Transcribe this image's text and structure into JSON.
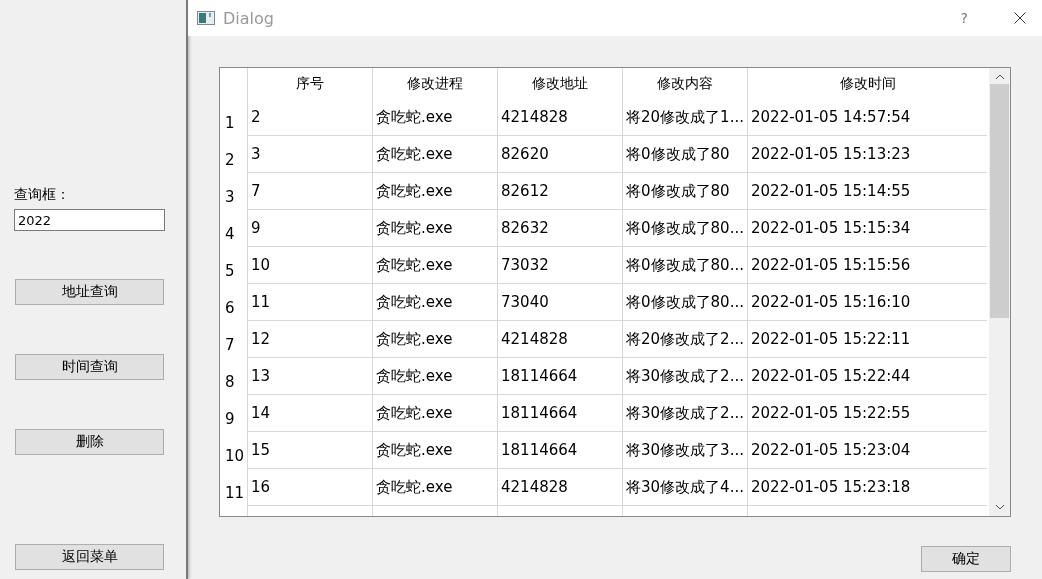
{
  "sidebar": {
    "search_label": "查询框：",
    "search_value": "2022",
    "buttons": [
      "地址查询",
      "时间查询",
      "删除",
      "返回菜单"
    ]
  },
  "window": {
    "title": "Dialog",
    "help": "?"
  },
  "table": {
    "columns": [
      "序号",
      "修改进程",
      "修改地址",
      "修改内容",
      "修改时间"
    ],
    "rows": [
      {
        "header": "1",
        "cells": [
          "2",
          "贪吃蛇.exe",
          "4214828",
          "将20修改成了1...",
          "2022-01-05 14:57:54"
        ]
      },
      {
        "header": "2",
        "cells": [
          "3",
          "贪吃蛇.exe",
          "82620",
          "将0修改成了80",
          "2022-01-05 15:13:23"
        ]
      },
      {
        "header": "3",
        "cells": [
          "7",
          "贪吃蛇.exe",
          "82612",
          "将0修改成了80",
          "2022-01-05 15:14:55"
        ]
      },
      {
        "header": "4",
        "cells": [
          "9",
          "贪吃蛇.exe",
          "82632",
          "将0修改成了80...",
          "2022-01-05 15:15:34"
        ]
      },
      {
        "header": "5",
        "cells": [
          "10",
          "贪吃蛇.exe",
          "73032",
          "将0修改成了80...",
          "2022-01-05 15:15:56"
        ]
      },
      {
        "header": "6",
        "cells": [
          "11",
          "贪吃蛇.exe",
          "73040",
          "将0修改成了80...",
          "2022-01-05 15:16:10"
        ]
      },
      {
        "header": "7",
        "cells": [
          "12",
          "贪吃蛇.exe",
          "4214828",
          "将20修改成了2...",
          "2022-01-05 15:22:11"
        ]
      },
      {
        "header": "8",
        "cells": [
          "13",
          "贪吃蛇.exe",
          "18114664",
          "将30修改成了2...",
          "2022-01-05 15:22:44"
        ]
      },
      {
        "header": "9",
        "cells": [
          "14",
          "贪吃蛇.exe",
          "18114664",
          "将30修改成了2...",
          "2022-01-05 15:22:55"
        ]
      },
      {
        "header": "10",
        "cells": [
          "15",
          "贪吃蛇.exe",
          "18114664",
          "将30修改成了3...",
          "2022-01-05 15:23:04"
        ]
      },
      {
        "header": "11",
        "cells": [
          "16",
          "贪吃蛇.exe",
          "4214828",
          "将30修改成了4...",
          "2022-01-05 15:23:18"
        ]
      }
    ]
  },
  "ok_button": "确定"
}
